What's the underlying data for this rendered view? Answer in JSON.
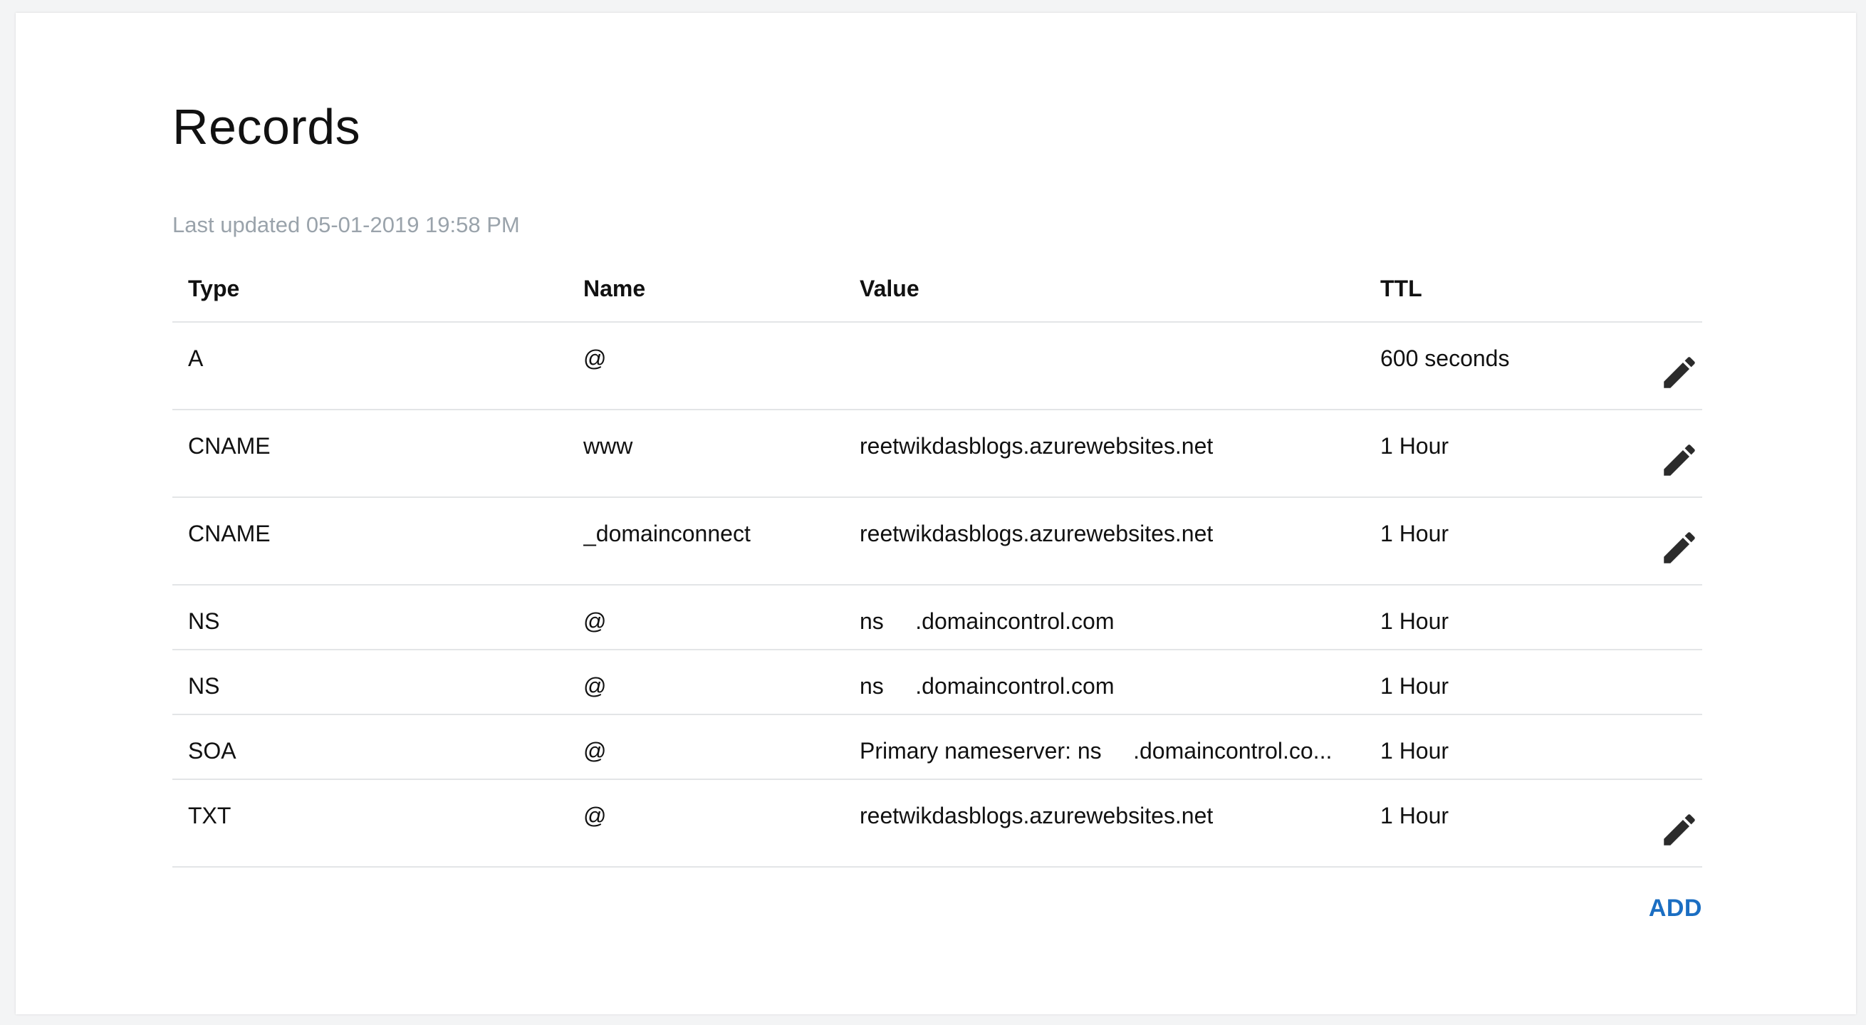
{
  "page": {
    "title": "Records",
    "last_updated": "Last updated 05-01-2019 19:58 PM"
  },
  "table": {
    "columns": {
      "type": "Type",
      "name": "Name",
      "value": "Value",
      "ttl": "TTL"
    },
    "rows": [
      {
        "type": "A",
        "name": "@",
        "value": "",
        "ttl": "600 seconds",
        "editable": true
      },
      {
        "type": "CNAME",
        "name": "www",
        "value": "reetwikdasblogs.azurewebsites.net",
        "ttl": "1 Hour",
        "editable": true
      },
      {
        "type": "CNAME",
        "name": "_domainconnect",
        "value": "reetwikdasblogs.azurewebsites.net",
        "ttl": "1 Hour",
        "editable": true
      },
      {
        "type": "NS",
        "name": "@",
        "value": "ns     .domaincontrol.com",
        "ttl": "1 Hour",
        "editable": false
      },
      {
        "type": "NS",
        "name": "@",
        "value": "ns     .domaincontrol.com",
        "ttl": "1 Hour",
        "editable": false
      },
      {
        "type": "SOA",
        "name": "@",
        "value": "Primary nameserver: ns     .domaincontrol.co...",
        "ttl": "1 Hour",
        "editable": false
      },
      {
        "type": "TXT",
        "name": "@",
        "value": "reetwikdasblogs.azurewebsites.net",
        "ttl": "1 Hour",
        "editable": true
      }
    ]
  },
  "actions": {
    "add_label": "ADD"
  },
  "icons": {
    "edit": "pencil-icon"
  },
  "colors": {
    "accent": "#1b6ec2",
    "muted_text": "#9aa3ab",
    "divider": "#e3e5e7"
  }
}
